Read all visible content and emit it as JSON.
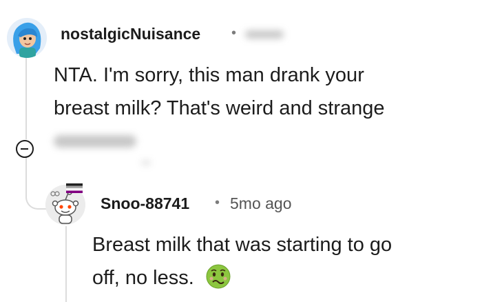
{
  "comment1": {
    "username": "nostalgicNuisance",
    "separator": "•",
    "body_line1": "NTA. I'm sorry, this man drank your",
    "body_line2": "breast milk? That's weird and strange"
  },
  "comment2": {
    "username": "Snoo-88741",
    "separator": "•",
    "time": "5mo ago",
    "body_line1": "Breast milk that was starting to go",
    "body_line2": "off, no less."
  },
  "icons": {
    "collapse": "collapse-thread-icon",
    "emoji": "nauseated-face-emoji"
  },
  "colors": {
    "thread_line": "#dcdcdc",
    "text": "#1c1c1c",
    "meta": "#555555"
  }
}
